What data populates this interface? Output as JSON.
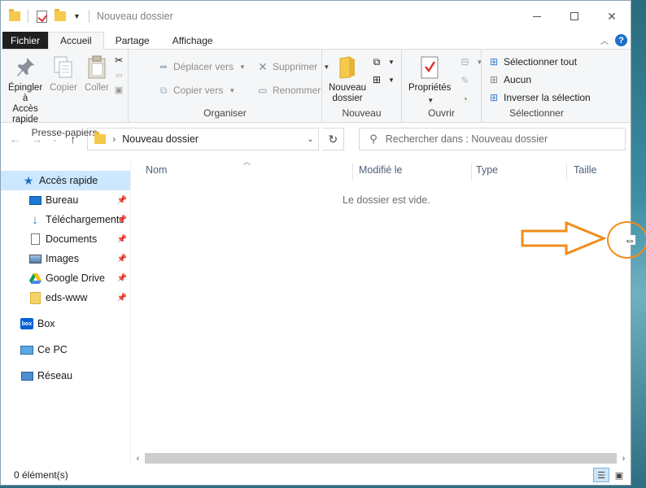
{
  "window": {
    "title": "Nouveau dossier"
  },
  "tabs": {
    "file": "Fichier",
    "home": "Accueil",
    "share": "Partage",
    "view": "Affichage"
  },
  "ribbon": {
    "clipboard": {
      "label": "Presse-papiers",
      "pin": "Épingler à\nAccès rapide",
      "pin_l1": "Épingler à",
      "pin_l2": "Accès rapide",
      "copy": "Copier",
      "paste": "Coller"
    },
    "organize": {
      "label": "Organiser",
      "move_to": "Déplacer vers",
      "copy_to": "Copier vers",
      "delete": "Supprimer",
      "rename": "Renommer"
    },
    "new": {
      "label": "Nouveau",
      "new_folder_l1": "Nouveau",
      "new_folder_l2": "dossier"
    },
    "open": {
      "label": "Ouvrir",
      "properties": "Propriétés"
    },
    "select": {
      "label": "Sélectionner",
      "select_all": "Sélectionner tout",
      "select_none": "Aucun",
      "invert": "Inverser la sélection"
    }
  },
  "address": {
    "path": "Nouveau dossier",
    "search_placeholder": "Rechercher dans : Nouveau dossier"
  },
  "nav": {
    "quick_access": "Accès rapide",
    "items": [
      {
        "label": "Bureau"
      },
      {
        "label": "Téléchargements"
      },
      {
        "label": "Documents"
      },
      {
        "label": "Images"
      },
      {
        "label": "Google Drive"
      },
      {
        "label": "eds-www"
      }
    ],
    "box": "Box",
    "this_pc": "Ce PC",
    "network": "Réseau"
  },
  "content": {
    "columns": {
      "name": "Nom",
      "modified": "Modifié le",
      "type": "Type",
      "size": "Taille"
    },
    "empty_message": "Le dossier est vide."
  },
  "status": {
    "count": "0 élément(s)"
  },
  "colors": {
    "annotation": "#f28c1c",
    "selection": "#cce8ff",
    "accent": "#1a6fc9"
  }
}
